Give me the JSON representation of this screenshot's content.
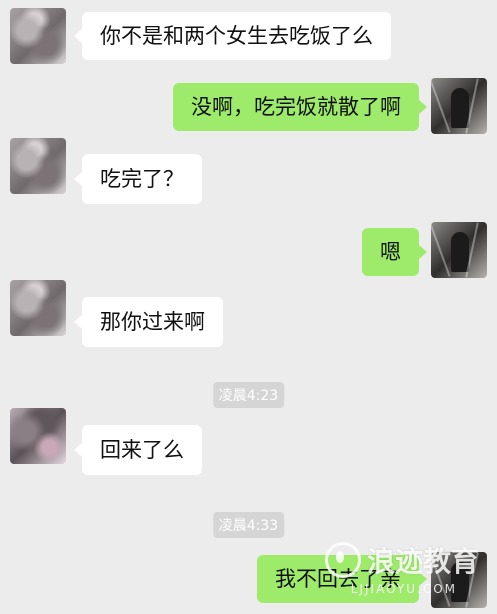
{
  "messages": [
    {
      "side": "left",
      "text": "你不是和两个女生去吃饭了么"
    },
    {
      "side": "right",
      "text": "没啊，吃完饭就散了啊"
    },
    {
      "side": "left",
      "text": "吃完了？"
    },
    {
      "side": "right",
      "text": "嗯"
    },
    {
      "side": "left",
      "text": "那你过来啊"
    },
    {
      "time": "凌晨4:23"
    },
    {
      "side": "left",
      "text": "回来了么"
    },
    {
      "time": "凌晨4:33"
    },
    {
      "side": "right",
      "text": "我不回去了亲"
    }
  ],
  "watermark": {
    "brand": "浪迹教育",
    "sub": "LJJIAOYU.COM"
  },
  "colors": {
    "background": "#ececec",
    "bubble_left": "#ffffff",
    "bubble_right": "#9eea6a",
    "time_badge": "#d5d5d5"
  }
}
